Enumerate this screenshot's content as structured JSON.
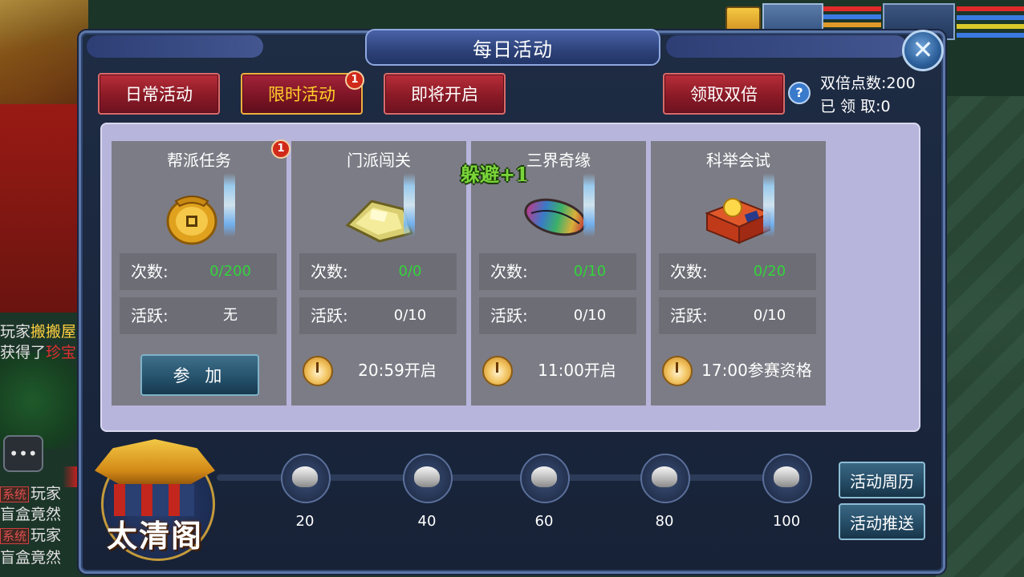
{
  "window": {
    "title": "每日活动"
  },
  "tabs": [
    {
      "label": "日常活动",
      "active": false
    },
    {
      "label": "限时活动",
      "active": true,
      "badge": "1"
    },
    {
      "label": "即将开启",
      "active": false
    }
  ],
  "double": {
    "button_label": "领取双倍",
    "points_text": "双倍点数:200",
    "claimed_text": "已 领 取:0"
  },
  "cards": [
    {
      "title": "帮派任务",
      "badge": "1",
      "icon": "gold-coin-pouch-icon",
      "count_label": "次数:",
      "count_value": "0/200",
      "active_label": "活跃:",
      "active_value": "无",
      "join_label": "参 加"
    },
    {
      "title": "门派闯关",
      "icon": "gold-ingot-pile-icon",
      "count_label": "次数:",
      "count_value": "0/0",
      "active_label": "活跃:",
      "active_value": "0/10",
      "time_text": "20:59开启"
    },
    {
      "title": "三界奇缘",
      "icon": "rainbow-stone-icon",
      "count_label": "次数:",
      "count_value": "0/10",
      "active_label": "活跃:",
      "active_value": "0/10",
      "time_text": "11:00开启"
    },
    {
      "title": "科举会试",
      "icon": "treasure-box-icon",
      "count_label": "次数:",
      "count_value": "0/20",
      "active_label": "活跃:",
      "active_value": "0/10",
      "time_text": "17:00参赛资格"
    }
  ],
  "floating_text": "躲避+1",
  "emblem_text": "太清阁",
  "milestones": [
    "20",
    "40",
    "60",
    "80",
    "100"
  ],
  "side_buttons": {
    "calendar": "活动周历",
    "push": "活动推送"
  },
  "chat": {
    "line1_a": "玩家",
    "line1_b": "搬搬屋",
    "line2_a": "获得了",
    "line2_b": "珍宝",
    "sys_tag": "系统",
    "line3": "玩家",
    "line4": "盲盒竟然",
    "line5": "玩家",
    "line6": "盲盒竟然"
  },
  "colors": {
    "green_count": "#33d43a",
    "active_tab_text": "#ffd02a",
    "content_bg": "#b7b5db"
  }
}
